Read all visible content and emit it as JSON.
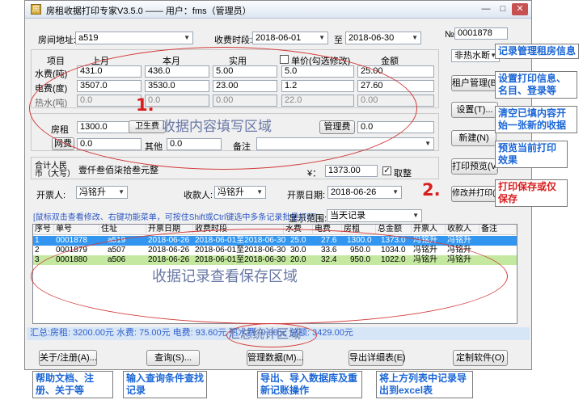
{
  "window": {
    "title": "房租收据打印专家V3.5.0 —— 用户：fms（管理员）",
    "min": "—",
    "max": "□",
    "close": "✕",
    "icon_glyph": "房"
  },
  "form": {
    "address_label": "房间地址:",
    "address_value": "a519",
    "period_label": "收费时段:",
    "period_from": "2018-06-01",
    "period_to_label": "至",
    "period_to": "2018-06-30",
    "no_label": "№",
    "no_value": "0001878",
    "heading_item": "项目",
    "heading_last": "上月",
    "heading_this": "本月",
    "heading_used": "实用",
    "unit_check_label": "单价(勾选修改)",
    "heading_amount": "金额",
    "rows": [
      {
        "label": "水费(吨)",
        "last": "431.0",
        "this": "436.0",
        "used": "5.00",
        "price": "5.0",
        "amount": "25.00",
        "gray": false
      },
      {
        "label": "电费(度)",
        "last": "3507.0",
        "this": "3530.0",
        "used": "23.00",
        "price": "1.2",
        "amount": "27.60",
        "gray": false
      },
      {
        "label": "热水(吨)",
        "last": "0.0",
        "this": "0.0",
        "used": "0.00",
        "price": "22.0",
        "amount": "0.00",
        "gray": true
      }
    ],
    "hot_water_select": "非热水断",
    "rent_label": "房租",
    "rent_value": "1300.0",
    "hygiene_label": "卫生费",
    "mgmt_label": "管理费",
    "mgmt_value": "0.0",
    "net_label": "网费",
    "net_value": "0.0",
    "other_label": "其他",
    "other_value": "0.0",
    "note_label": "备注",
    "note_value": "",
    "total_cn_label": "合计人民币（大写）",
    "total_cn_value": "壹仟叁佰柒拾叁元整",
    "yen_label": "¥：",
    "total_value": "1373.00",
    "ok_check_label": "取整",
    "issuer_label": "开票人:",
    "issuer_value": "冯铭升",
    "receiver_label": "收款人:",
    "receiver_value": "冯铭升",
    "issue_date_label": "开票日期:",
    "issue_date_value": "2018-06-26",
    "hint": "[鼠标双击查看修改、右键功能菜单，可按住Shift或Ctrl键选中多条记录批量打印]",
    "range_label": "显示范围:",
    "range_value": "当天记录"
  },
  "side_buttons": {
    "rent_mgmt": "租户管理(B)...",
    "settings": "设置(T)...",
    "new": "新建(N)",
    "preview": "打印预览(V)...",
    "save_print": "修改并打印(M)"
  },
  "table": {
    "headers": [
      "序号",
      "单号",
      "住址",
      "开票日期",
      "收费时段",
      "水费",
      "电费",
      "房租",
      "总金额",
      "开票人",
      "收款人",
      "备注"
    ],
    "rows": [
      [
        "1",
        "0001878",
        "a519",
        "2018-06-26",
        "2018-06-01至2018-06-30",
        "25.0",
        "27.6",
        "1300.0",
        "1373.0",
        "冯铭升",
        "冯铭升",
        ""
      ],
      [
        "2",
        "0001879",
        "a507",
        "2018-06-26",
        "2018-06-01至2018-06-30",
        "30.0",
        "33.6",
        "950.0",
        "1034.0",
        "冯铭升",
        "冯铭升",
        ""
      ],
      [
        "3",
        "0001880",
        "a506",
        "2018-06-26",
        "2018-06-01至2018-06-30",
        "20.0",
        "32.4",
        "950.0",
        "1022.0",
        "冯铭升",
        "冯铭升",
        ""
      ]
    ]
  },
  "status_bar": "汇总:房租: 3200.00元   水费: 75.00元   电费: 93.60元  热水费: 0.00元   总额: 3429.00元",
  "bottom_buttons": {
    "about": "关于/注册(A)...",
    "query": "查询(S)...",
    "db": "管理数据(M)...",
    "export": "导出详细表(E)",
    "custom": "定制软件(O)"
  },
  "annotations": {
    "area1_num": "1.",
    "area1_text": "收据内容填写区域",
    "area2_num": "2.",
    "area_records": "收据记录查看保存区域",
    "area_summary": "汇总统计区域",
    "side": [
      "记录管理租房信息",
      "设置打印信息、名目、登录等",
      "清空已填内容开始一张新的收据",
      "预览当前打印效果",
      "打印保存或仅保存"
    ],
    "bottom": [
      "帮助文档、注册、关于等",
      "输入查询条件查找记录",
      "导出、导入数据库及重新记账操作",
      "将上方列表中记录导出到excel表"
    ]
  }
}
